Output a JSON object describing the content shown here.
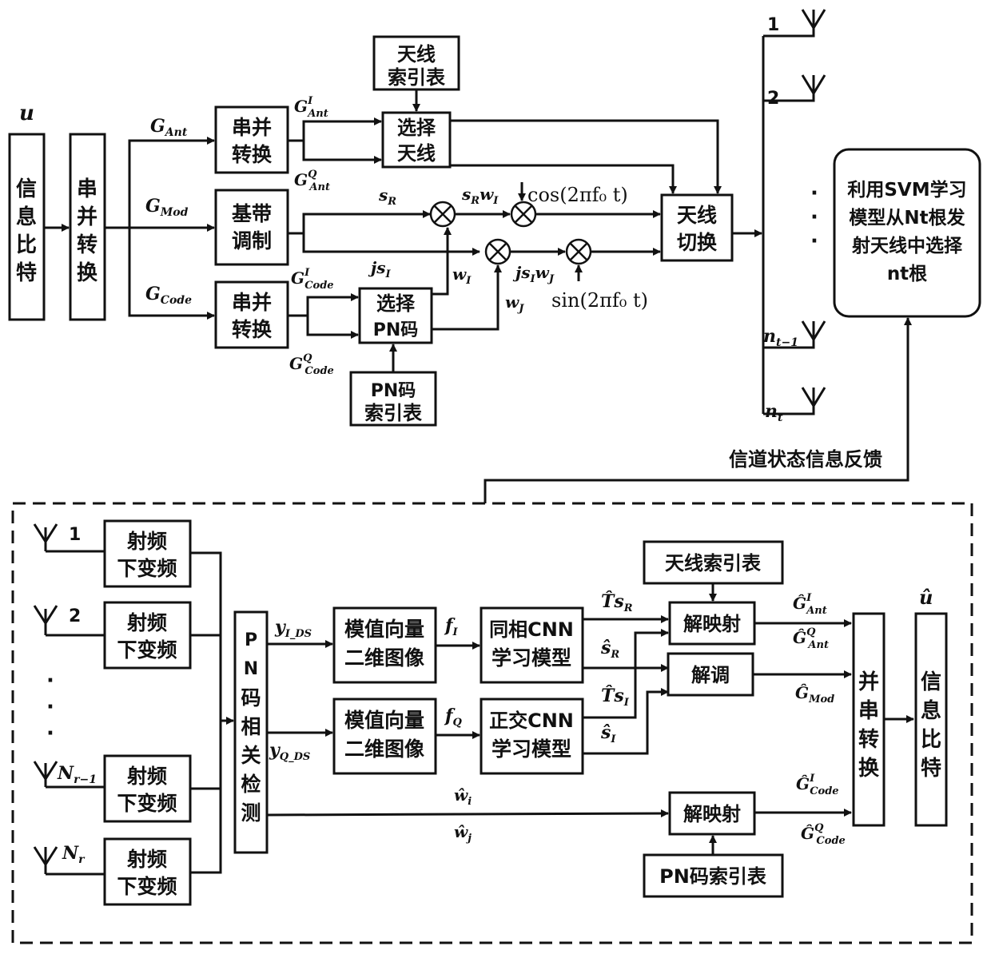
{
  "transmitter": {
    "input_label": "u",
    "info_bits": [
      "信",
      "息",
      "比",
      "特"
    ],
    "sp_main": [
      "串",
      "并",
      "转",
      "换"
    ],
    "sp_ant": [
      "串并",
      "转换"
    ],
    "baseband": [
      "基带",
      "调制"
    ],
    "sp_code": [
      "串并",
      "转换"
    ],
    "ant_index_table": [
      "天线",
      "索引表"
    ],
    "select_antenna": [
      "选择",
      "天线"
    ],
    "select_pn": [
      "选择",
      "PN码"
    ],
    "pn_index_table": [
      "PN码",
      "索引表"
    ],
    "antenna_switch": [
      "天线",
      "切换"
    ],
    "svm_box": [
      "利用SVM学习",
      "模型从Nt根发",
      "射天线中选择",
      "nt根"
    ],
    "feedback_label": "信道状态信息反馈",
    "signals": {
      "g_ant": "G",
      "g_ant_sub": "Ant",
      "g_mod": "G",
      "g_mod_sub": "Mod",
      "g_code": "G",
      "g_code_sub": "Code",
      "g_ant_i_sup": "I",
      "g_ant_q_sup": "Q",
      "g_code_i_sup": "I",
      "g_code_q_sup": "Q",
      "s_r": "s",
      "s_r_sub": "R",
      "js_i": "js",
      "js_i_sub": "I",
      "s_r_w_i": "s",
      "s_r_w_i_mid": "R",
      "s_r_w_i_w": "w",
      "s_r_w_i_sub": "I",
      "js_i_w_j": "js",
      "js_i_w_j_mid": "I",
      "js_i_w_j_w": "w",
      "js_i_w_j_sub": "J",
      "w_i": "w",
      "w_i_sub": "I",
      "w_j": "w",
      "w_j_sub": "J",
      "cos_carrier": "cos(2πf₀ t)",
      "sin_carrier": "sin(2πf₀ t)"
    },
    "tx_antennas": [
      {
        "label": "1"
      },
      {
        "label": "2"
      },
      {
        "label": "n",
        "sub": "t−1"
      },
      {
        "label": "n",
        "sub": "t"
      }
    ],
    "ellipsis": "·"
  },
  "receiver": {
    "rx_antennas": [
      {
        "label": "1"
      },
      {
        "label": "2"
      },
      {
        "label": "N",
        "sub": "r−1"
      },
      {
        "label": "N",
        "sub": "r"
      }
    ],
    "rf_down": [
      "射频",
      "下变频"
    ],
    "pn_detect": [
      "P",
      "N",
      "码",
      "相",
      "关",
      "检",
      "测"
    ],
    "mod_vec_image": [
      "模值向量",
      "二维图像"
    ],
    "cnn_i": [
      "同相CNN",
      "学习模型"
    ],
    "cnn_q": [
      "正交CNN",
      "学习模型"
    ],
    "ant_index_table": "天线索引表",
    "demap_ant": "解映射",
    "demod": "解调",
    "demap_code": "解映射",
    "pn_index_table": "PN码索引表",
    "ps_convert": [
      "并",
      "串",
      "转",
      "换"
    ],
    "info_bits": [
      "信",
      "息",
      "比",
      "特"
    ],
    "output_label": "û",
    "signals": {
      "y_i": "y",
      "y_i_sub": "I_DS",
      "y_q": "y",
      "y_q_sub": "Q_DS",
      "f_i": "f",
      "f_i_sub": "I",
      "f_q": "f",
      "f_q_sub": "Q",
      "ts_r": "T̂s",
      "ts_r_sub": "R",
      "s_r_hat": "ŝ",
      "s_r_hat_sub": "R",
      "ts_i": "T̂s",
      "ts_i_sub": "I",
      "s_i_hat": "ŝ",
      "s_i_hat_sub": "I",
      "w_i_hat": "ŵ",
      "w_i_hat_sub": "i",
      "w_j_hat": "ŵ",
      "w_j_hat_sub": "j",
      "g_ant_hat": "Ĝ",
      "g_ant_hat_sub": "Ant",
      "g_ant_hat_i": "I",
      "g_ant_hat_q": "Q",
      "g_mod_hat": "Ĝ",
      "g_mod_hat_sub": "Mod",
      "g_code_hat": "Ĝ",
      "g_code_hat_sub": "Code",
      "g_code_hat_i": "I",
      "g_code_hat_q": "Q"
    }
  }
}
